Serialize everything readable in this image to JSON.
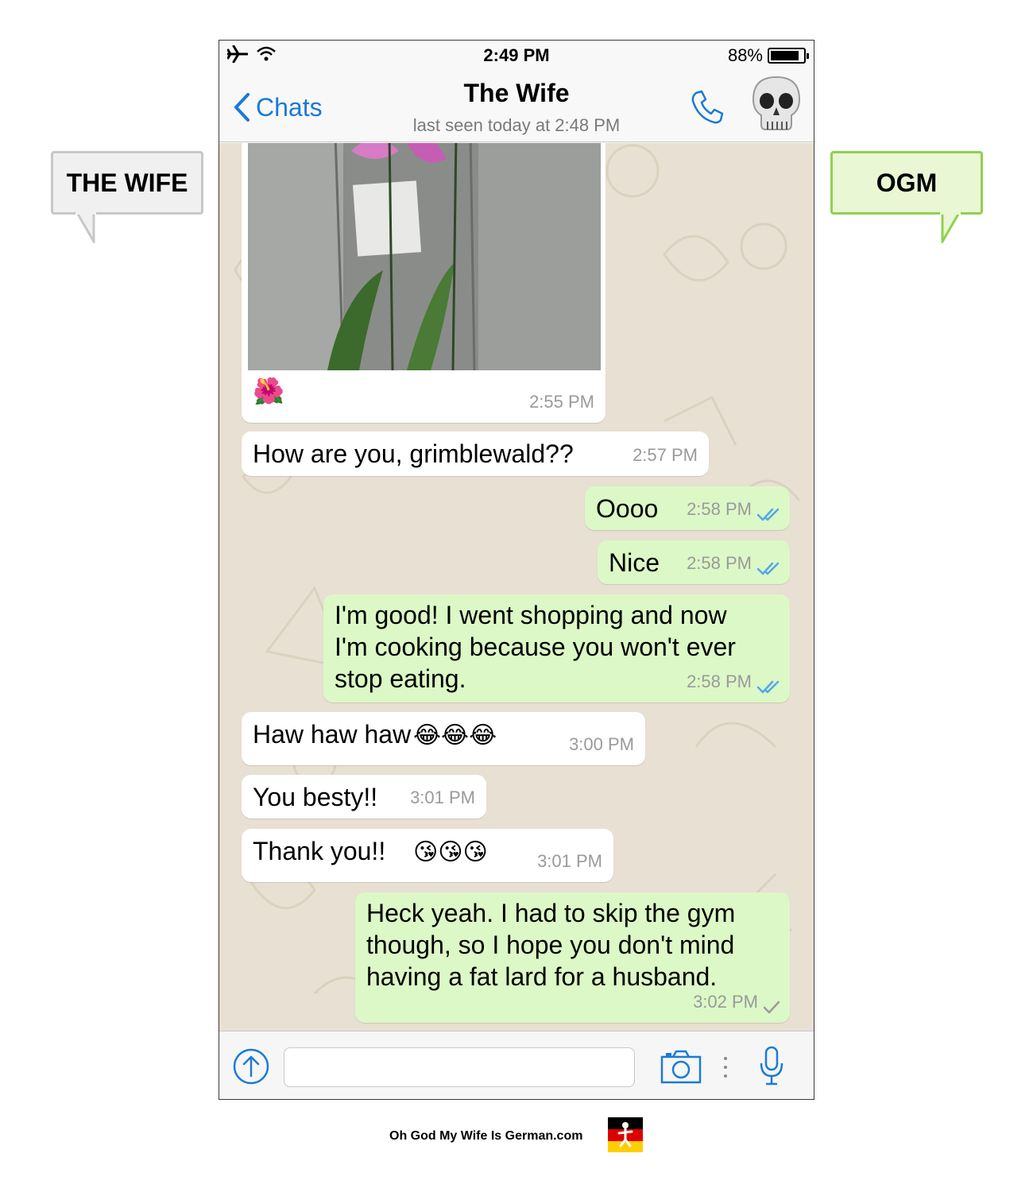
{
  "callouts": {
    "left": "THE WIFE",
    "right": "OGM"
  },
  "status_bar": {
    "time": "2:49 PM",
    "battery_percent": "88%",
    "battery_level": 0.88
  },
  "nav": {
    "back_label": "Chats",
    "contact_name": "The Wife",
    "last_seen": "last seen today at 2:48 PM"
  },
  "messages": [
    {
      "direction": "in",
      "type": "image",
      "caption": "🌺",
      "time": "2:55 PM"
    },
    {
      "direction": "in",
      "text": "How are you, grimblewald??",
      "time": "2:57 PM"
    },
    {
      "direction": "out",
      "text": "Oooo",
      "time": "2:58 PM",
      "status": "read"
    },
    {
      "direction": "out",
      "text": "Nice",
      "time": "2:58 PM",
      "status": "read"
    },
    {
      "direction": "out",
      "lines": [
        "I'm good! I went shopping and now",
        "I'm cooking because you won't ever",
        "stop eating."
      ],
      "time": "2:58 PM",
      "status": "read"
    },
    {
      "direction": "in",
      "text": "Haw haw haw",
      "emoji": "😂😂😂",
      "time": "3:00 PM"
    },
    {
      "direction": "in",
      "text": "You besty!!",
      "time": "3:01 PM"
    },
    {
      "direction": "in",
      "text": "Thank you!!",
      "emoji": "😘😘😘",
      "time": "3:01 PM"
    },
    {
      "direction": "out",
      "lines": [
        "Heck yeah. I had to skip the gym",
        "though, so I hope you don't mind",
        "having a fat lard for a husband."
      ],
      "time": "3:02 PM",
      "status": "sent"
    }
  ],
  "footer": {
    "site": "Oh God My Wife Is German.com"
  }
}
